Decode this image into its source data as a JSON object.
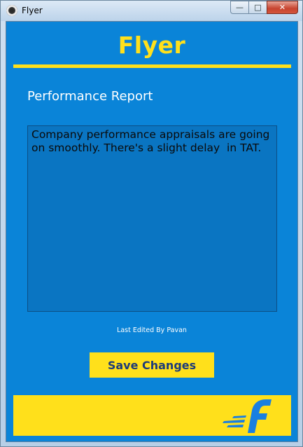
{
  "window": {
    "title": "Flyer",
    "controls": {
      "minimize": "—",
      "maximize": "□",
      "close": "✕"
    }
  },
  "header": {
    "title": "Flyer"
  },
  "report": {
    "title": "Performance Report",
    "text": "Company performance appraisals are going on smoothly. There's a slight delay  in TAT.",
    "last_edited": "Last Edited By Pavan"
  },
  "actions": {
    "save_label": "Save Changes"
  },
  "colors": {
    "background": "#0a84d8",
    "accent": "#ffe01b",
    "button_text": "#1c3a7a"
  },
  "footer": {
    "logo_icon": "flipkart-f-logo"
  }
}
